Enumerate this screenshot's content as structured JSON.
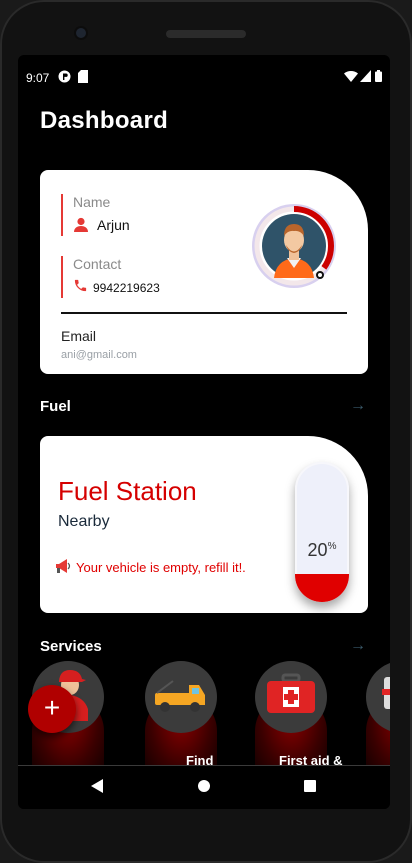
{
  "status": {
    "time": "9:07"
  },
  "page": {
    "title": "Dashboard"
  },
  "profile": {
    "name_label": "Name",
    "name": "Arjun",
    "contact_label": "Contact",
    "contact": "9942219623",
    "email_label": "Email",
    "email": "ani@gmail.com",
    "progress_ring_fraction": 0.35
  },
  "fuel": {
    "section_title": "Fuel",
    "card_title": "Fuel Station",
    "card_subtitle": "Nearby",
    "message": "Your vehicle is empty, refill it!.",
    "level_value": "20",
    "level_unit": "%",
    "level_fraction": 0.2
  },
  "services": {
    "section_title": "Services",
    "items": [
      {
        "label": "",
        "icon": "mechanic-icon"
      },
      {
        "label": "Find",
        "icon": "tow-truck-icon"
      },
      {
        "label": "First aid &",
        "icon": "first-aid-kit-icon"
      },
      {
        "label": "",
        "icon": "spark-plug-icon"
      }
    ]
  },
  "fab": {
    "label": "+"
  },
  "colors": {
    "accent": "#e00000",
    "background": "#000000",
    "card": "#ffffff"
  }
}
